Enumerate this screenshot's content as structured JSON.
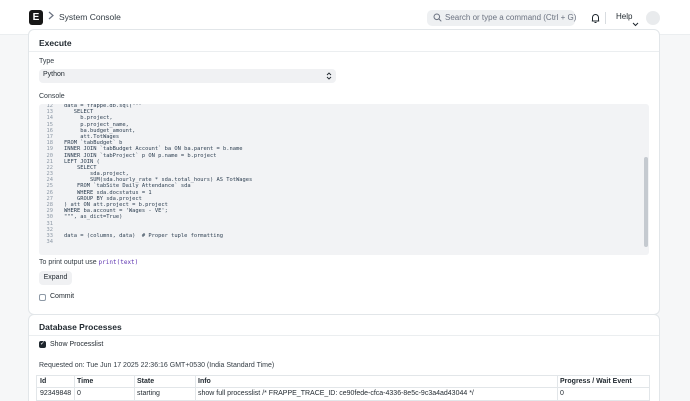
{
  "navbar": {
    "logo_letter": "E",
    "breadcrumb": "System Console",
    "search_placeholder": "Search or type a command (Ctrl + G)",
    "help_label": "Help"
  },
  "execute": {
    "title": "Execute",
    "type_label": "Type",
    "type_value": "Python",
    "console_label": "Console",
    "code_lines": [
      {
        "n": "12",
        "t": "data = frappe.db.sql(\"\"\""
      },
      {
        "n": "13",
        "t": "   SELECT"
      },
      {
        "n": "14",
        "t": "     b.project,"
      },
      {
        "n": "15",
        "t": "     p.project_name,"
      },
      {
        "n": "16",
        "t": "     ba.budget_amount,"
      },
      {
        "n": "17",
        "t": "     att.TotWages"
      },
      {
        "n": "18",
        "t": "FROM `tabBudget` b"
      },
      {
        "n": "19",
        "t": "INNER JOIN `tabBudget Account` ba ON ba.parent = b.name"
      },
      {
        "n": "20",
        "t": "INNER JOIN `tabProject` p ON p.name = b.project"
      },
      {
        "n": "21",
        "t": "LEFT JOIN ("
      },
      {
        "n": "22",
        "t": "    SELECT"
      },
      {
        "n": "23",
        "t": "        sda.project,"
      },
      {
        "n": "24",
        "t": "        SUM(sda.hourly_rate * sda.total_hours) AS TotWages"
      },
      {
        "n": "25",
        "t": "    FROM `tabSite Daily Attendance` sda"
      },
      {
        "n": "26",
        "t": "    WHERE sda.docstatus = 1"
      },
      {
        "n": "27",
        "t": "    GROUP BY sda.project"
      },
      {
        "n": "28",
        "t": ") att ON att.project = b.project"
      },
      {
        "n": "29",
        "t": "WHERE ba.account = 'Wages - VE';"
      },
      {
        "n": "30",
        "t": "\"\"\", as_dict=True)"
      },
      {
        "n": "31",
        "t": ""
      },
      {
        "n": "32",
        "t": ""
      },
      {
        "n": "33",
        "t": "data = (columns, data)  # Proper tuple formatting"
      },
      {
        "n": "34",
        "t": ""
      }
    ],
    "print_hint_prefix": "To print output use",
    "print_hint_code": "print(text)",
    "expand_label": "Expand",
    "commit_label": "Commit",
    "commit_checked": false
  },
  "db_processes": {
    "title": "Database Processes",
    "show_processlist_label": "Show Processlist",
    "show_processlist_checked": true,
    "requested_on": "Requested on: Tue Jun 17 2025 22:36:16 GMT+0530 (India Standard Time)",
    "columns": [
      "Id",
      "Time",
      "State",
      "Info",
      "Progress / Wait Event"
    ],
    "rows": [
      [
        "92349848",
        "0",
        "starting",
        "show full processlist /* FRAPPE_TRACE_ID: ce90fede-cfca-4336-8e5c-9c3a4ad43044 */",
        "0"
      ]
    ]
  }
}
